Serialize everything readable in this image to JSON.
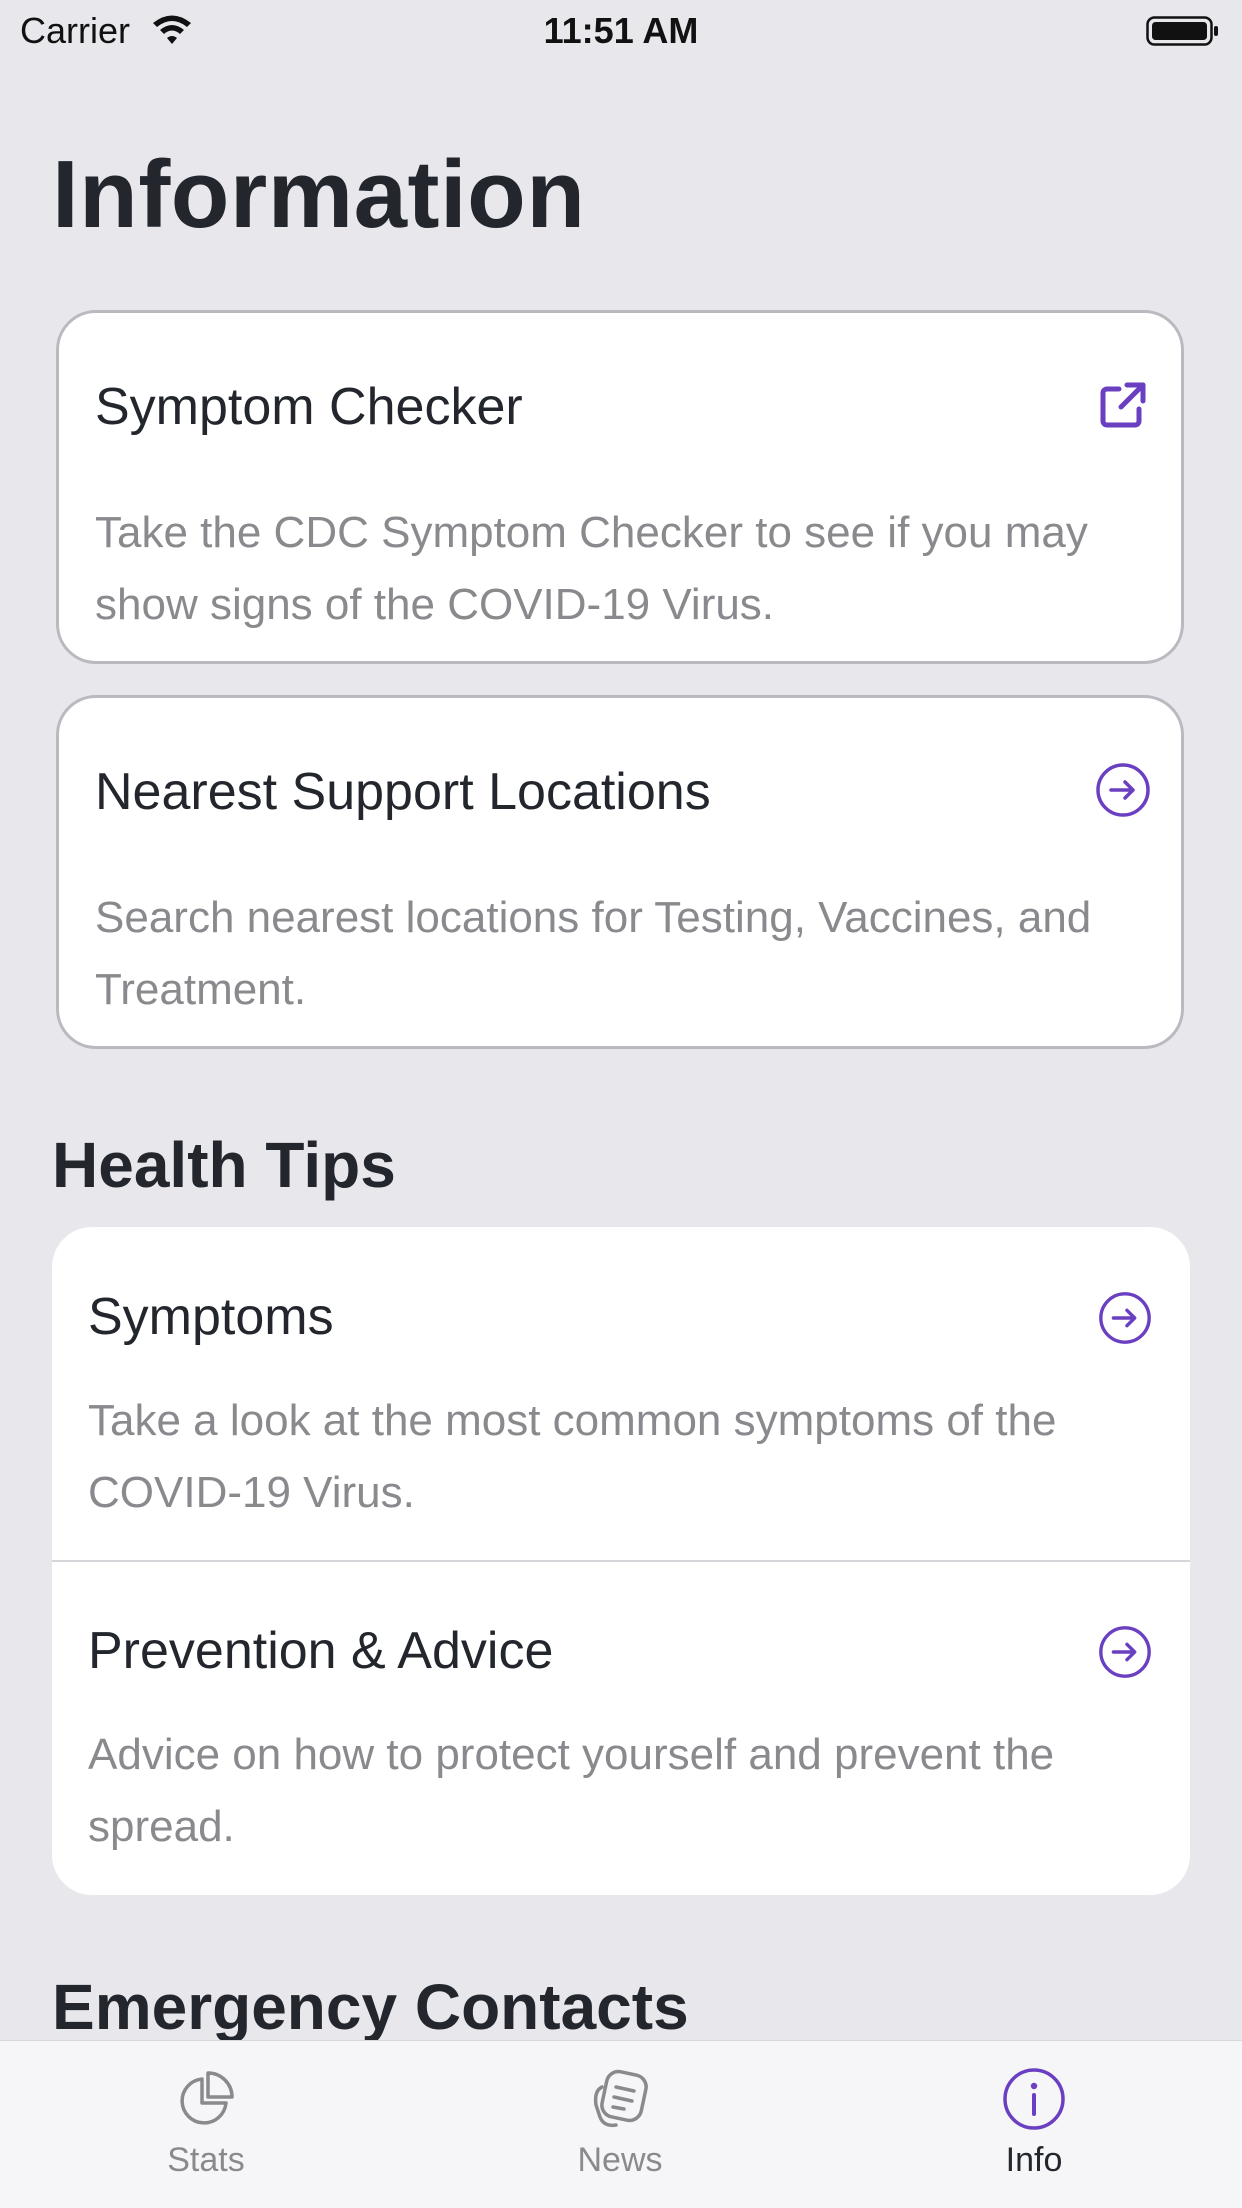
{
  "status_bar": {
    "carrier": "Carrier",
    "time": "11:51 AM"
  },
  "page": {
    "title": "Information"
  },
  "cards": [
    {
      "title": "Symptom Checker",
      "description": "Take the CDC Symptom Checker to see if you may show signs of the COVID-19 Virus.",
      "icon": "external-link-icon"
    },
    {
      "title": "Nearest Support Locations",
      "description": "Search nearest locations for Testing, Vaccines, and Treatment.",
      "icon": "arrow-circle-right-icon"
    }
  ],
  "health_tips": {
    "heading": "Health Tips",
    "items": [
      {
        "title": "Symptoms",
        "description": "Take a look at the most common symptoms of the COVID-19 Virus.",
        "icon": "arrow-circle-right-icon"
      },
      {
        "title": "Prevention & Advice",
        "description": "Advice on how to protect yourself and prevent the spread.",
        "icon": "arrow-circle-right-icon"
      }
    ]
  },
  "emergency": {
    "heading": "Emergency Contacts"
  },
  "tab_bar": {
    "tabs": [
      {
        "label": "Stats",
        "icon": "chart-pie-icon",
        "selected": false
      },
      {
        "label": "News",
        "icon": "newspaper-icon",
        "selected": false
      },
      {
        "label": "Info",
        "icon": "info-circle-icon",
        "selected": true
      }
    ]
  },
  "colors": {
    "accent": "#6a3fc1",
    "background": "#e8e7ec",
    "card": "#ffffff",
    "secondary_text": "#8a8a8e",
    "primary_text": "#23272d"
  }
}
